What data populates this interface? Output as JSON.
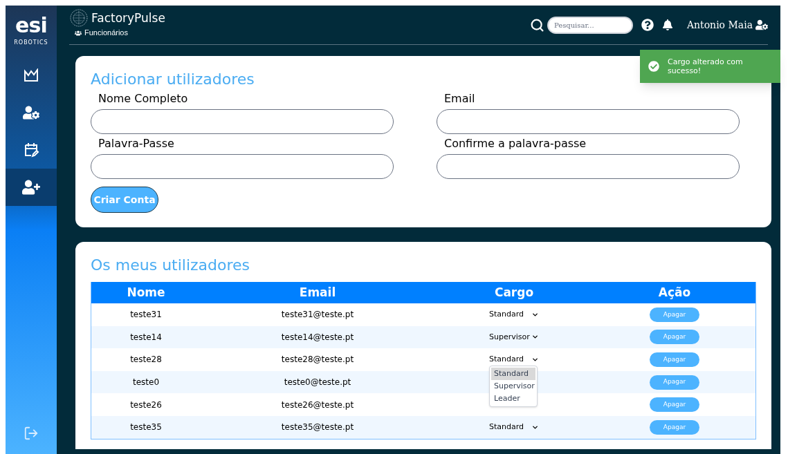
{
  "logo": {
    "name": "esi",
    "tagline": "ROBOTICS"
  },
  "sidebar": {
    "items": [
      {
        "kind": "chart",
        "selected": false
      },
      {
        "kind": "user-settings",
        "selected": false
      },
      {
        "kind": "calendar-edit",
        "selected": false
      },
      {
        "kind": "add-user",
        "selected": true
      }
    ]
  },
  "header": {
    "app_title": "FactoryPulse",
    "breadcrumb": "Funcionários",
    "search": {
      "placeholder": "Pesquisar..."
    },
    "user_name": "Antonio Maia"
  },
  "toast": {
    "message": "Cargo alterado com sucesso!"
  },
  "add_users": {
    "title": "Adicionar utilizadores",
    "fields": [
      {
        "label": "Nome Completo"
      },
      {
        "label": "Email"
      },
      {
        "label": "Palavra-Passe"
      },
      {
        "label": "Confirme a palavra-passe"
      }
    ],
    "button": "Criar Conta"
  },
  "users": {
    "title": "Os meus utilizadores",
    "columns": [
      "Nome",
      "Email",
      "Cargo",
      "Ação"
    ],
    "rows": [
      {
        "name": "teste31",
        "email": "teste31@teste.pt",
        "cargo": {
          "value": "Standard"
        },
        "action": "Apagar"
      },
      {
        "name": "teste14",
        "email": "teste14@teste.pt",
        "cargo": {
          "value": "Supervisor"
        },
        "action": "Apagar"
      },
      {
        "name": "teste28",
        "email": "teste28@teste.pt",
        "cargo": {
          "value": "Standard",
          "options": [
            {
              "label": "Standard",
              "selected": true
            },
            {
              "label": "Supervisor",
              "selected": false
            },
            {
              "label": "Leader",
              "selected": false
            }
          ]
        },
        "action": "Apagar"
      },
      {
        "name": "teste0",
        "email": "teste0@teste.pt",
        "action": "Apagar"
      },
      {
        "name": "teste26",
        "email": "teste26@teste.pt",
        "action": "Apagar"
      },
      {
        "name": "teste35",
        "email": "teste35@teste.pt",
        "cargo": {
          "value": "Standard"
        },
        "action": "Apagar"
      }
    ]
  }
}
